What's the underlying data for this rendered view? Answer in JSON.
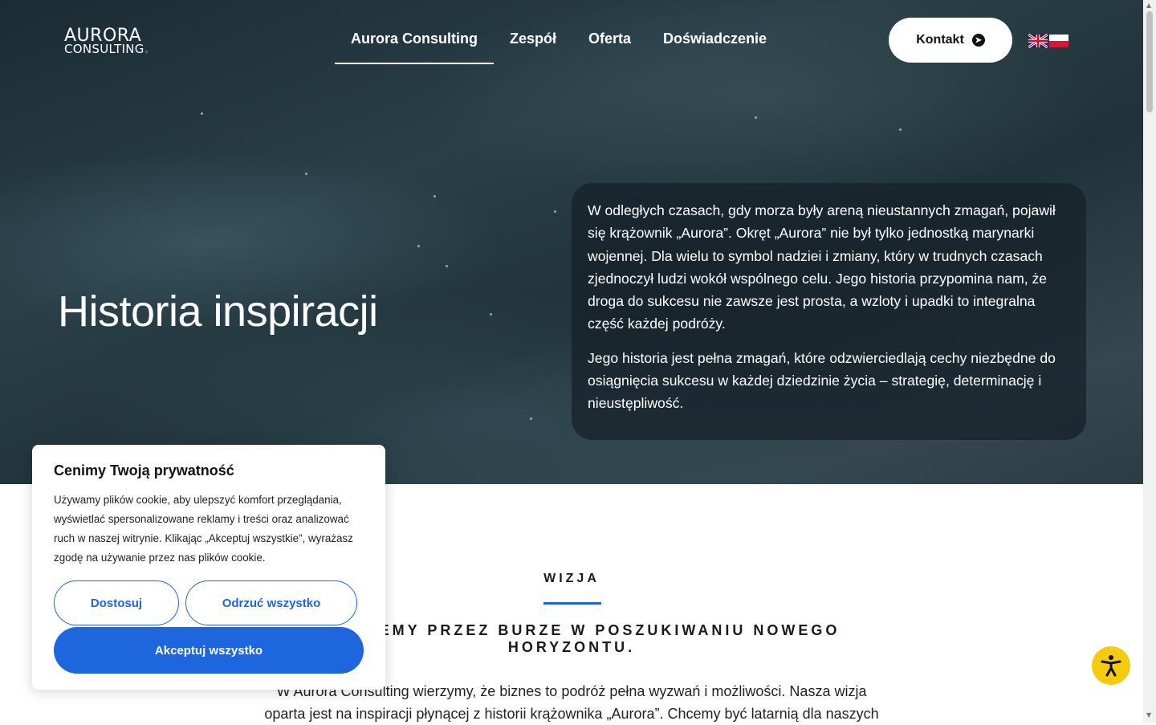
{
  "header": {
    "logo_line1": "AURORA",
    "logo_line2": "CONSULTING",
    "logo_dot": ".",
    "nav": [
      {
        "label": "Aurora Consulting",
        "active": true
      },
      {
        "label": "Zespół"
      },
      {
        "label": "Oferta"
      },
      {
        "label": "Doświadczenie"
      }
    ],
    "contact_button": "Kontakt",
    "languages": [
      "en-flag-icon",
      "pl-flag-icon"
    ]
  },
  "hero": {
    "title": "Historia inspiracji",
    "paragraph1": "W odległych czasach, gdy morza były areną nieustannych zmagań, pojawił się krążownik „Aurora”. Okręt „Aurora” nie był tylko jednostką marynarki wojennej. Dla wielu to symbol nadziei i zmiany, który w trudnych czasach zjednoczył ludzi wokół wspólnego celu. Jego historia przypomina nam, że droga do sukcesu nie zawsze jest prosta, a wzloty i upadki to integralna część każdej podróży.",
    "paragraph2": "Jego historia jest pełna zmagań, które odzwierciedlają cechy niezbędne do osiągnięcia sukcesu w każdej dziedzinie życia – strategię, determinację i nieustępliwość."
  },
  "vision": {
    "eyebrow": "WIZJA",
    "heading": "ŻEGLUJEMY PRZEZ BURZE W POSZUKIWANIU NOWEGO HORYZONTU.",
    "text": "W Aurora Consulting wierzymy, że biznes to podróż pełna wyzwań i możliwości. Nasza wizja oparta jest na inspiracji płynącej z historii krążownika „Aurora”. Chcemy być latarnią dla naszych"
  },
  "cookie": {
    "title": "Cenimy Twoją prywatność",
    "text": "Używamy plików cookie, aby ulepszyć komfort przeglądania, wyświetlać spersonalizowane reklamy i treści oraz analizować ruch w naszej witrynie. Klikając „Akceptuj wszystkie”, wyrażasz zgodę na używanie przez nas plików cookie.",
    "customize": "Dostosuj",
    "reject": "Odrzuć wszystko",
    "accept": "Akceptuj wszystko"
  },
  "colors": {
    "accent": "#1d66de",
    "accessibility": "#f5cb10"
  },
  "icons": {
    "contact_arrow": "arrow-right-circle-icon",
    "accessibility": "accessibility-icon"
  }
}
